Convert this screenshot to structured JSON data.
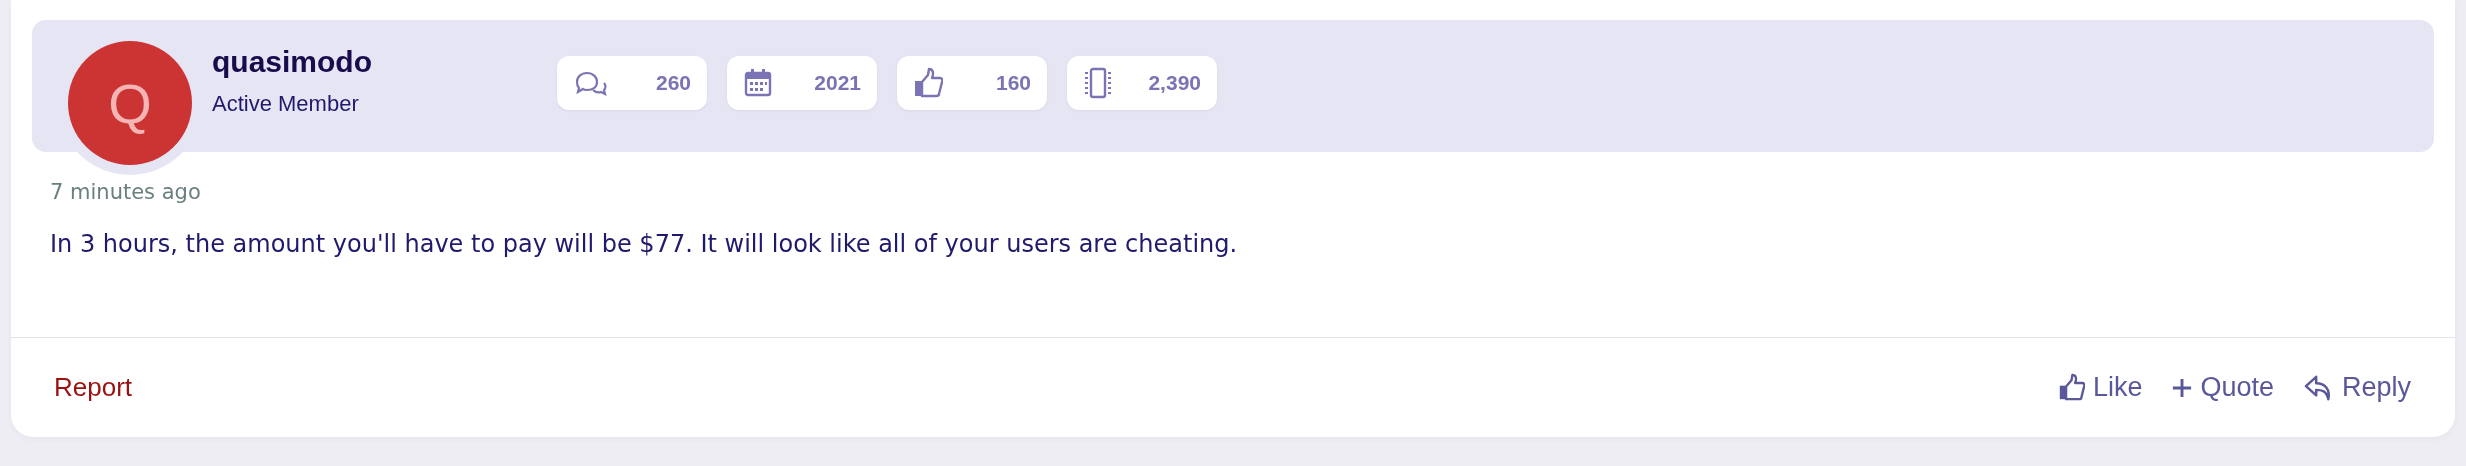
{
  "author": {
    "initial": "Q",
    "name": "quasimodo",
    "role": "Active Member"
  },
  "stats": [
    {
      "kind": "messages",
      "value": "260"
    },
    {
      "kind": "calendar",
      "value": "2021"
    },
    {
      "kind": "like",
      "value": "160"
    },
    {
      "kind": "points",
      "value": "2,390"
    }
  ],
  "post": {
    "time": "7 minutes ago",
    "text": "In 3 hours, the amount you'll have to pay will be $77. It will look like all of your users are cheating."
  },
  "footer": {
    "report": "Report",
    "actions": [
      {
        "kind": "like",
        "label": "Like"
      },
      {
        "kind": "quote",
        "label": "Quote"
      },
      {
        "kind": "reply",
        "label": "Reply"
      }
    ]
  }
}
